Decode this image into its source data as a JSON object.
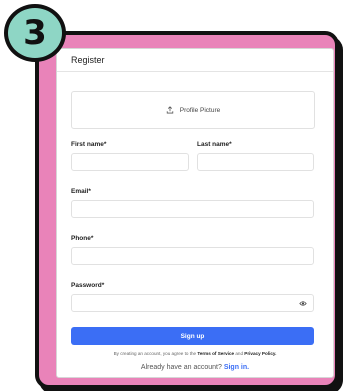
{
  "step": {
    "number": "3"
  },
  "form": {
    "title": "Register",
    "profile_picture_label": "Profile Picture",
    "first_name_label": "First name*",
    "last_name_label": "Last name*",
    "email_label": "Email*",
    "phone_label": "Phone*",
    "password_label": "Password*",
    "signup_label": "Sign up",
    "terms_prefix": "By creating an account, you agree to the",
    "terms_link": "Terms of Service",
    "terms_and": "and",
    "privacy_link": "Privacy Policy.",
    "already_text": "Already have an account?",
    "signin_link": "Sign in."
  },
  "colors": {
    "frame_pink": "#e983b9",
    "badge_teal": "#8ed6c5",
    "primary_blue": "#3b6ef5"
  },
  "icons": {
    "upload": "upload-icon",
    "password_toggle": "eye-icon"
  }
}
